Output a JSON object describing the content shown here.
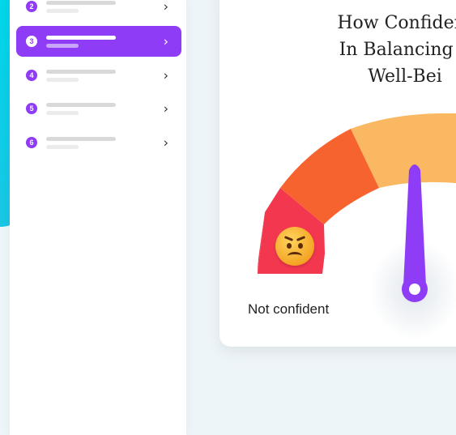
{
  "steps": [
    {
      "number": "2",
      "active": false
    },
    {
      "number": "3",
      "active": true
    },
    {
      "number": "4",
      "active": false
    },
    {
      "number": "5",
      "active": false
    },
    {
      "number": "6",
      "active": false
    }
  ],
  "chevron": "›",
  "question": {
    "line1": "How Confident",
    "line2": "In Balancing P",
    "line3": "Well-Bei"
  },
  "gauge": {
    "low_label": "Not confident",
    "low_emoji": "angry-face-icon",
    "segment_colors": [
      "#f2374f",
      "#f7632f",
      "#f98c35",
      "#fbb862"
    ],
    "needle_color": "#8f3cf7"
  }
}
